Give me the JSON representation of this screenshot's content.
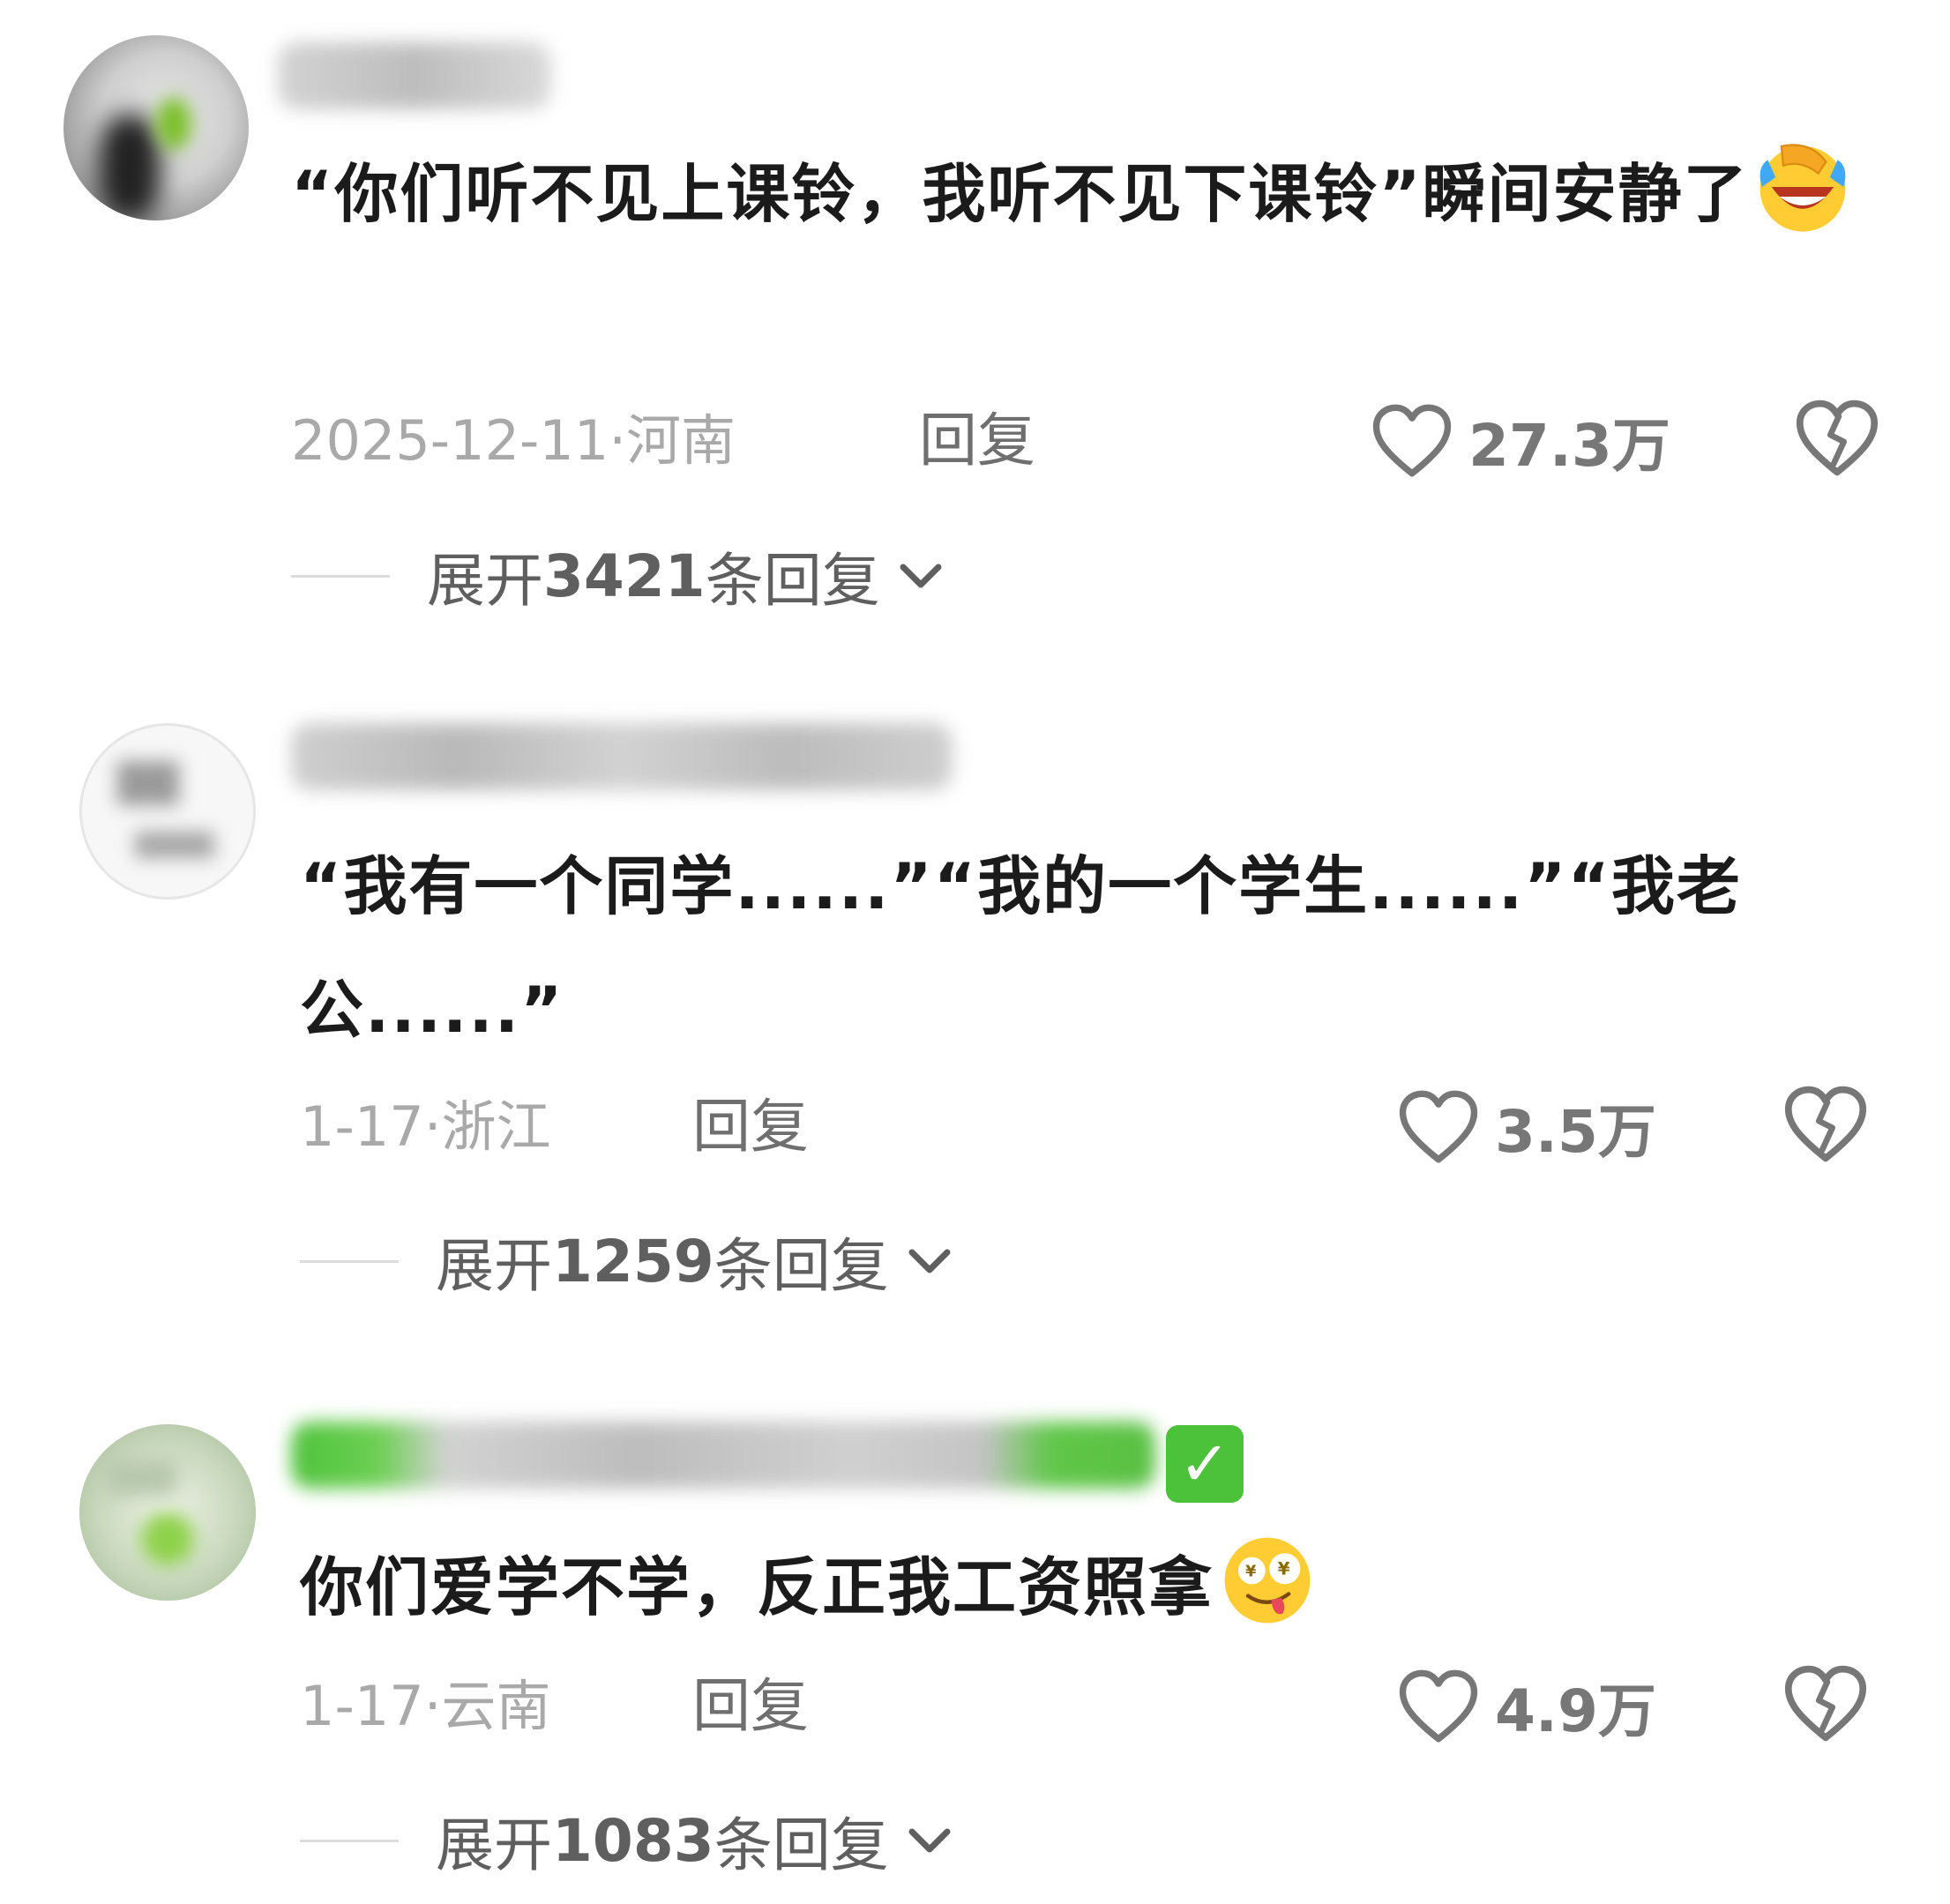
{
  "comments": [
    {
      "content": "“你们听不见上课铃，我听不见下课铃”瞬间安静了",
      "emoji": "facepalm-laughing-emoji",
      "date": "2025-12-11",
      "sep": "·",
      "region": "河南",
      "reply_label": "回复",
      "likes": "27.3万",
      "expand_prefix": "展开",
      "expand_count": "3421",
      "expand_suffix": "条回复"
    },
    {
      "content": "“我有一个同学......”“我的一个学生......”“我老公......”",
      "date": "1-17",
      "sep": "·",
      "region": "浙江",
      "reply_label": "回复",
      "likes": "3.5万",
      "expand_prefix": "展开",
      "expand_count": "1259",
      "expand_suffix": "条回复"
    },
    {
      "verified_badge": "✅",
      "content": "你们爱学不学，反正我工资照拿",
      "emoji": "money-eyes-tongue-emoji",
      "date": "1-17",
      "sep": "·",
      "region": "云南",
      "reply_label": "回复",
      "likes": "4.9万",
      "expand_prefix": "展开",
      "expand_count": "1083",
      "expand_suffix": "条回复"
    }
  ],
  "colors": {
    "text": "#1b1b1b",
    "meta": "#a9a9a9",
    "reply": "#6f6f6f",
    "icon": "#777777"
  },
  "icons": [
    "heart-outline-icon",
    "broken-heart-icon",
    "chevron-down-icon"
  ]
}
